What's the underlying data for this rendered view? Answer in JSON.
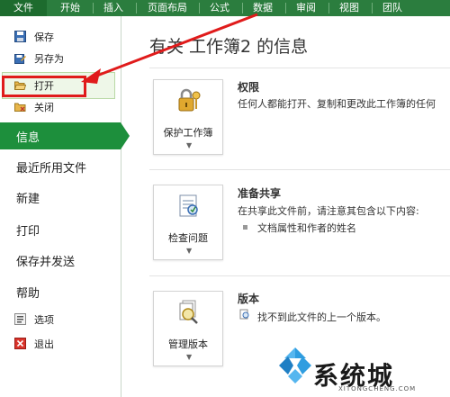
{
  "ribbon": {
    "tabs": [
      "文件",
      "开始",
      "插入",
      "页面布局",
      "公式",
      "数据",
      "审阅",
      "视图",
      "团队"
    ]
  },
  "left_menu": {
    "small_top": [
      "保存",
      "另存为",
      "打开",
      "关闭"
    ],
    "big": [
      "信息",
      "最近所用文件",
      "新建",
      "打印",
      "保存并发送",
      "帮助"
    ],
    "small_bottom": [
      "选项",
      "退出"
    ]
  },
  "main": {
    "title": "有关 工作簿2 的信息",
    "sections": [
      {
        "button": "保护工作簿",
        "heading": "权限",
        "lines": [
          "任何人都能打开、复制和更改此工作簿的任何"
        ]
      },
      {
        "button": "检查问题",
        "heading": "准备共享",
        "lines": [
          "在共享此文件前，请注意其包含以下内容:"
        ],
        "bullets": [
          "文档属性和作者的姓名"
        ]
      },
      {
        "button": "管理版本",
        "heading": "版本",
        "lines": [
          "找不到此文件的上一个版本。"
        ]
      }
    ]
  },
  "watermark": {
    "text": "系统城",
    "url": "XITONGCHENG.COM"
  },
  "colors": {
    "ribbon_green": "#2b7d3e",
    "active_green": "#1d8f3c",
    "annotation_red": "#e01b1b"
  }
}
